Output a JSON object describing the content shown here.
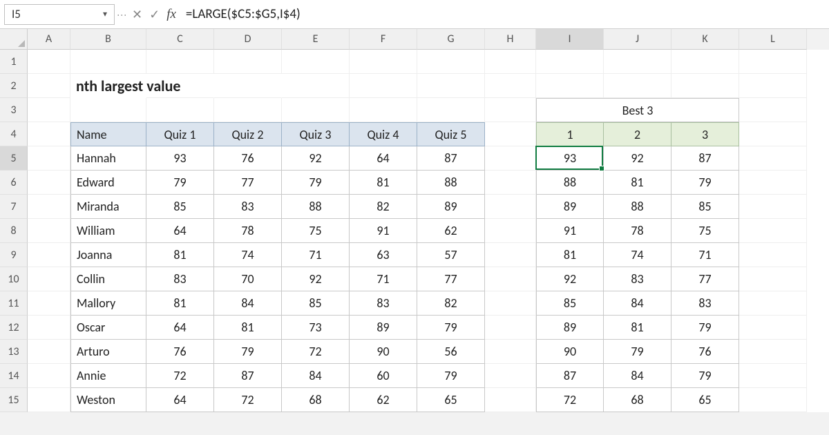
{
  "name_box": "I5",
  "formula": "=LARGE($C5:$G5,I$4)",
  "columns": [
    "A",
    "B",
    "C",
    "D",
    "E",
    "F",
    "G",
    "H",
    "I",
    "J",
    "K",
    "L"
  ],
  "rows": [
    1,
    2,
    3,
    4,
    5,
    6,
    7,
    8,
    9,
    10,
    11,
    12,
    13,
    14,
    15
  ],
  "active_col": "I",
  "active_row": 5,
  "title": "nth largest value",
  "best3_title": "Best 3",
  "quiz_headers": [
    "Name",
    "Quiz 1",
    "Quiz 2",
    "Quiz 3",
    "Quiz 4",
    "Quiz 5"
  ],
  "best3_headers": [
    "1",
    "2",
    "3"
  ],
  "students": [
    {
      "name": "Hannah",
      "q": [
        93,
        76,
        92,
        64,
        87
      ],
      "best": [
        93,
        92,
        87
      ]
    },
    {
      "name": "Edward",
      "q": [
        79,
        77,
        79,
        81,
        88
      ],
      "best": [
        88,
        81,
        79
      ]
    },
    {
      "name": "Miranda",
      "q": [
        85,
        83,
        88,
        82,
        89
      ],
      "best": [
        89,
        88,
        85
      ]
    },
    {
      "name": "William",
      "q": [
        64,
        78,
        75,
        91,
        62
      ],
      "best": [
        91,
        78,
        75
      ]
    },
    {
      "name": "Joanna",
      "q": [
        81,
        74,
        71,
        63,
        57
      ],
      "best": [
        81,
        74,
        71
      ]
    },
    {
      "name": "Collin",
      "q": [
        83,
        70,
        92,
        71,
        77
      ],
      "best": [
        92,
        83,
        77
      ]
    },
    {
      "name": "Mallory",
      "q": [
        81,
        84,
        85,
        83,
        82
      ],
      "best": [
        85,
        84,
        83
      ]
    },
    {
      "name": "Oscar",
      "q": [
        64,
        81,
        73,
        89,
        79
      ],
      "best": [
        89,
        81,
        79
      ]
    },
    {
      "name": "Arturo",
      "q": [
        76,
        79,
        72,
        90,
        56
      ],
      "best": [
        90,
        79,
        76
      ]
    },
    {
      "name": "Annie",
      "q": [
        72,
        87,
        84,
        60,
        79
      ],
      "best": [
        87,
        84,
        79
      ]
    },
    {
      "name": "Weston",
      "q": [
        64,
        72,
        68,
        62,
        65
      ],
      "best": [
        72,
        68,
        65
      ]
    }
  ]
}
